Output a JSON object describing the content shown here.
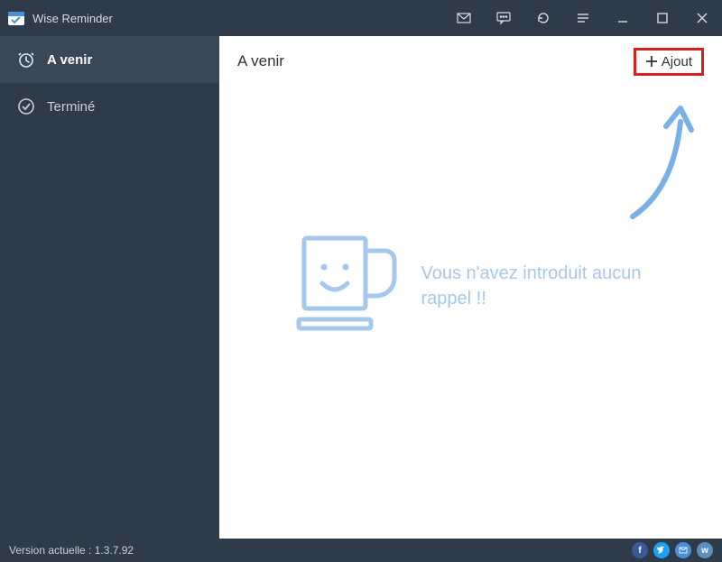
{
  "app": {
    "title": "Wise Reminder"
  },
  "sidebar": {
    "items": [
      {
        "label": "A venir"
      },
      {
        "label": "Terminé"
      }
    ]
  },
  "main": {
    "page_title": "A venir",
    "add_button": "Ajout",
    "empty_message": "Vous n'avez introduit aucun rappel !!"
  },
  "footer": {
    "version_label": "Version actuelle : 1.3.7.92"
  }
}
